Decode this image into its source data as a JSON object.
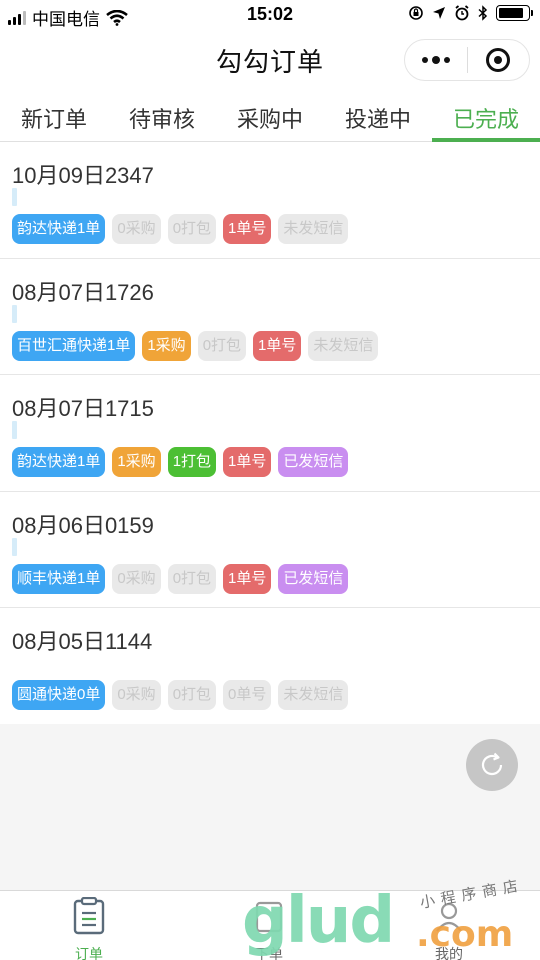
{
  "status_bar": {
    "carrier": "中国电信",
    "time": "15:02",
    "battery_level": 0.85
  },
  "nav": {
    "title": "勾勾订单"
  },
  "tabs": [
    {
      "label": "新订单",
      "active": false
    },
    {
      "label": "待审核",
      "active": false
    },
    {
      "label": "采购中",
      "active": false
    },
    {
      "label": "投递中",
      "active": false
    },
    {
      "label": "已完成",
      "active": true
    }
  ],
  "orders": [
    {
      "title": "10月09日2347",
      "tags": [
        {
          "text": "韵达快递1单",
          "color": "blue"
        },
        {
          "text": "0采购",
          "color": "gray"
        },
        {
          "text": "0打包",
          "color": "gray"
        },
        {
          "text": "1单号",
          "color": "red"
        },
        {
          "text": "未发短信",
          "color": "gray"
        }
      ]
    },
    {
      "title": "08月07日1726",
      "tags": [
        {
          "text": "百世汇通快递1单",
          "color": "blue"
        },
        {
          "text": "1采购",
          "color": "orange"
        },
        {
          "text": "0打包",
          "color": "gray"
        },
        {
          "text": "1单号",
          "color": "red"
        },
        {
          "text": "未发短信",
          "color": "gray"
        }
      ]
    },
    {
      "title": "08月07日1715",
      "tags": [
        {
          "text": "韵达快递1单",
          "color": "blue"
        },
        {
          "text": "1采购",
          "color": "orange"
        },
        {
          "text": "1打包",
          "color": "green"
        },
        {
          "text": "1单号",
          "color": "red"
        },
        {
          "text": "已发短信",
          "color": "purple"
        }
      ]
    },
    {
      "title": "08月06日0159",
      "tags": [
        {
          "text": "顺丰快递1单",
          "color": "blue"
        },
        {
          "text": "0采购",
          "color": "gray"
        },
        {
          "text": "0打包",
          "color": "gray"
        },
        {
          "text": "1单号",
          "color": "red"
        },
        {
          "text": "已发短信",
          "color": "purple"
        }
      ]
    },
    {
      "title": "08月05日1144",
      "tags": [
        {
          "text": "圆通快递0单",
          "color": "blue"
        },
        {
          "text": "0采购",
          "color": "gray"
        },
        {
          "text": "0打包",
          "color": "gray"
        },
        {
          "text": "0单号",
          "color": "gray"
        },
        {
          "text": "未发短信",
          "color": "gray"
        }
      ]
    }
  ],
  "bottom_bar": {
    "orders_label": "订单",
    "place_label": "下单",
    "mine_label": "我的"
  },
  "watermark": {
    "brand": "glud",
    "suffix": ".com",
    "tagline": "小程序商店"
  },
  "colors": {
    "accent_green": "#4caf50",
    "tag_blue": "#3ea6f3",
    "tag_orange": "#f0a438",
    "tag_green": "#4cbf34",
    "tag_red": "#e46b6b",
    "tag_purple": "#c98ef0",
    "tag_gray": "#e9e9e9"
  }
}
